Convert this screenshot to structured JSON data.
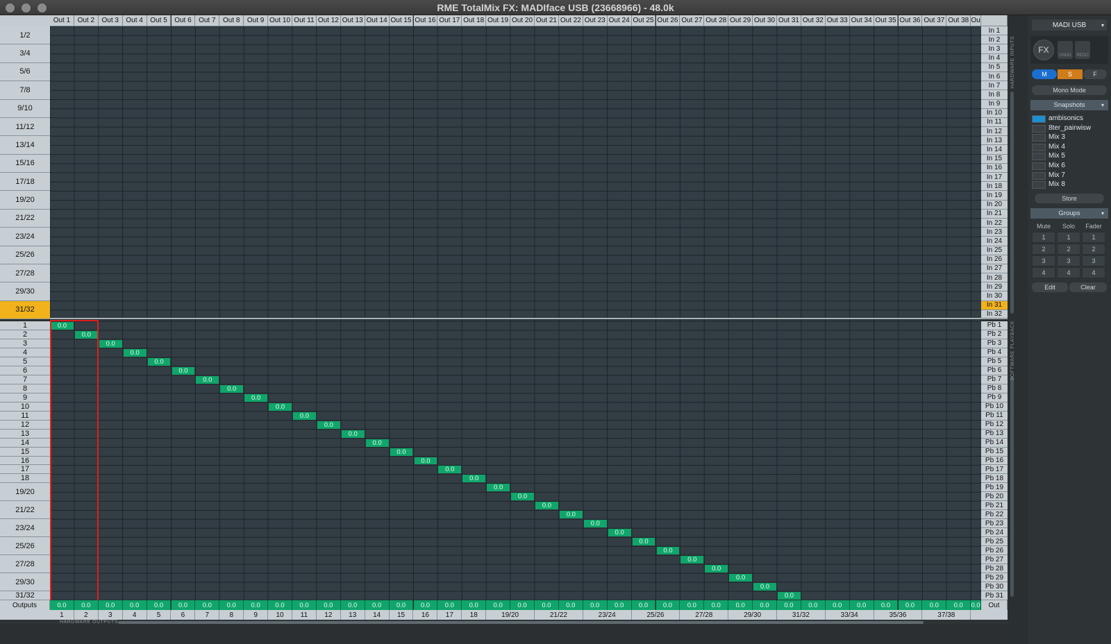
{
  "window": {
    "title": "RME TotalMix FX: MADIface USB (23668966) - 48.0k"
  },
  "hardware_inputs": {
    "columns": [
      "Out 1",
      "Out 2",
      "Out 3",
      "Out 4",
      "Out 5",
      "Out 6",
      "Out 7",
      "Out 8",
      "Out 9",
      "Out 10",
      "Out 11",
      "Out 12",
      "Out 13",
      "Out 14",
      "Out 15",
      "Out 16",
      "Out 17",
      "Out 18",
      "Out 19",
      "Out 20",
      "Out 21",
      "Out 22",
      "Out 23",
      "Out 24",
      "Out 25",
      "Out 26",
      "Out 27",
      "Out 28",
      "Out 29",
      "Out 30",
      "Out 31",
      "Out 32",
      "Out 33",
      "Out 34",
      "Out 35",
      "Out 36",
      "Out 37",
      "Out 38",
      "Ou"
    ],
    "left_rows": [
      "1/2",
      "3/4",
      "5/6",
      "7/8",
      "9/10",
      "11/12",
      "13/14",
      "15/16",
      "17/18",
      "19/20",
      "21/22",
      "23/24",
      "25/26",
      "27/28",
      "29/30",
      "31/32"
    ],
    "left_selected": "31/32",
    "right_rows": [
      "In 1",
      "In 2",
      "In 3",
      "In 4",
      "In 5",
      "In 6",
      "In 7",
      "In 8",
      "In 9",
      "In 10",
      "In 11",
      "In 12",
      "In 13",
      "In 14",
      "In 15",
      "In 16",
      "In 17",
      "In 18",
      "In 19",
      "In 20",
      "In 21",
      "In 22",
      "In 23",
      "In 24",
      "In 25",
      "In 26",
      "In 27",
      "In 28",
      "In 29",
      "In 30",
      "In 31",
      "In 32"
    ],
    "right_selected": "In 31",
    "side_label": "HARDWARE INPUTS"
  },
  "software_playback": {
    "left_rows": [
      "1",
      "2",
      "3",
      "4",
      "5",
      "6",
      "7",
      "8",
      "9",
      "10",
      "11",
      "12",
      "13",
      "14",
      "15",
      "16",
      "17",
      "18",
      "19/20",
      "21/22",
      "23/24",
      "25/26",
      "27/28",
      "29/30",
      "31/32"
    ],
    "right_rows": [
      "Pb 1",
      "Pb 2",
      "Pb 3",
      "Pb 4",
      "Pb 5",
      "Pb 6",
      "Pb 7",
      "Pb 8",
      "Pb 9",
      "Pb 10",
      "Pb 11",
      "Pb 12",
      "Pb 13",
      "Pb 14",
      "Pb 15",
      "Pb 16",
      "Pb 17",
      "Pb 18",
      "Pb 19",
      "Pb 20",
      "Pb 21",
      "Pb 22",
      "Pb 23",
      "Pb 24",
      "Pb 25",
      "Pb 26",
      "Pb 27",
      "Pb 28",
      "Pb 29",
      "Pb 30",
      "Pb 31"
    ],
    "routing_value": "0.0",
    "routed_count": 31,
    "side_label": "SOFTWARE PLAYBACK"
  },
  "outputs": {
    "label": "Outputs",
    "right_label": "Out",
    "value": "0.0",
    "bottom_labels": [
      "1",
      "2",
      "3",
      "4",
      "5",
      "6",
      "7",
      "8",
      "9",
      "10",
      "11",
      "12",
      "13",
      "14",
      "15",
      "16",
      "17",
      "18",
      "19/20",
      "21/22",
      "23/24",
      "25/26",
      "27/28",
      "29/30",
      "31/32",
      "33/34",
      "35/36",
      "37/38"
    ],
    "side_label": "HARDWARE OUTPUTS"
  },
  "sidebar": {
    "device": "MADI USB",
    "fx_label": "FX",
    "undo_label": "UNDO",
    "redo_label": "REDO",
    "m_label": "M",
    "s_label": "S",
    "f_label": "F",
    "mono_mode": "Mono Mode",
    "snapshots_title": "Snapshots",
    "snapshots": [
      {
        "name": "ambisonics",
        "active": true
      },
      {
        "name": "8ter_pairwisw",
        "active": false
      },
      {
        "name": "Mix 3",
        "active": false
      },
      {
        "name": "Mix 4",
        "active": false
      },
      {
        "name": "Mix 5",
        "active": false
      },
      {
        "name": "Mix 6",
        "active": false
      },
      {
        "name": "Mix 7",
        "active": false
      },
      {
        "name": "Mix 8",
        "active": false
      }
    ],
    "store": "Store",
    "groups_title": "Groups",
    "groups_headers": [
      "Mute",
      "Solo",
      "Fader"
    ],
    "groups_numbers": [
      "1",
      "2",
      "3",
      "4"
    ],
    "edit": "Edit",
    "clear": "Clear"
  },
  "colors": {
    "accent_selected": "#f2b21b",
    "routing_cell": "#10a56a",
    "snapshot_active": "#1a8fd1",
    "highlight_box": "#e02020"
  }
}
